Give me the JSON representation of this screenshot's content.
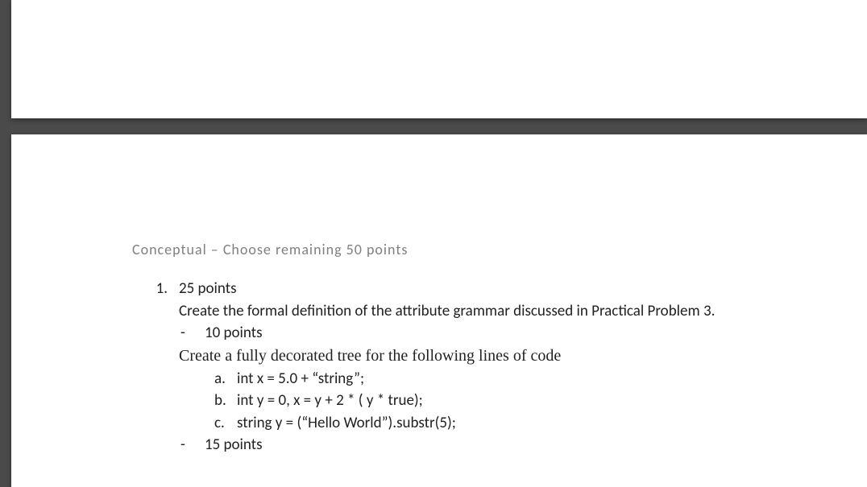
{
  "section_header": "Conceptual – Choose remaining 50 points",
  "question": {
    "number": "1.",
    "points": "25 points",
    "prompt_main": "Create the formal definition of the attribute grammar discussed in Practical Problem 3.",
    "sub1_points": "10 points",
    "prompt_tree": "Create a fully decorated tree for the following lines of code",
    "items": [
      {
        "letter": "a.",
        "code": "int x = 5.0 + “string”;"
      },
      {
        "letter": "b.",
        "code": "int y = 0, x = y + 2 * ( y * true);"
      },
      {
        "letter": "c.",
        "code": "string y = (“Hello World”).substr(5);"
      }
    ],
    "sub2_points": "15 points",
    "dash": "-"
  }
}
